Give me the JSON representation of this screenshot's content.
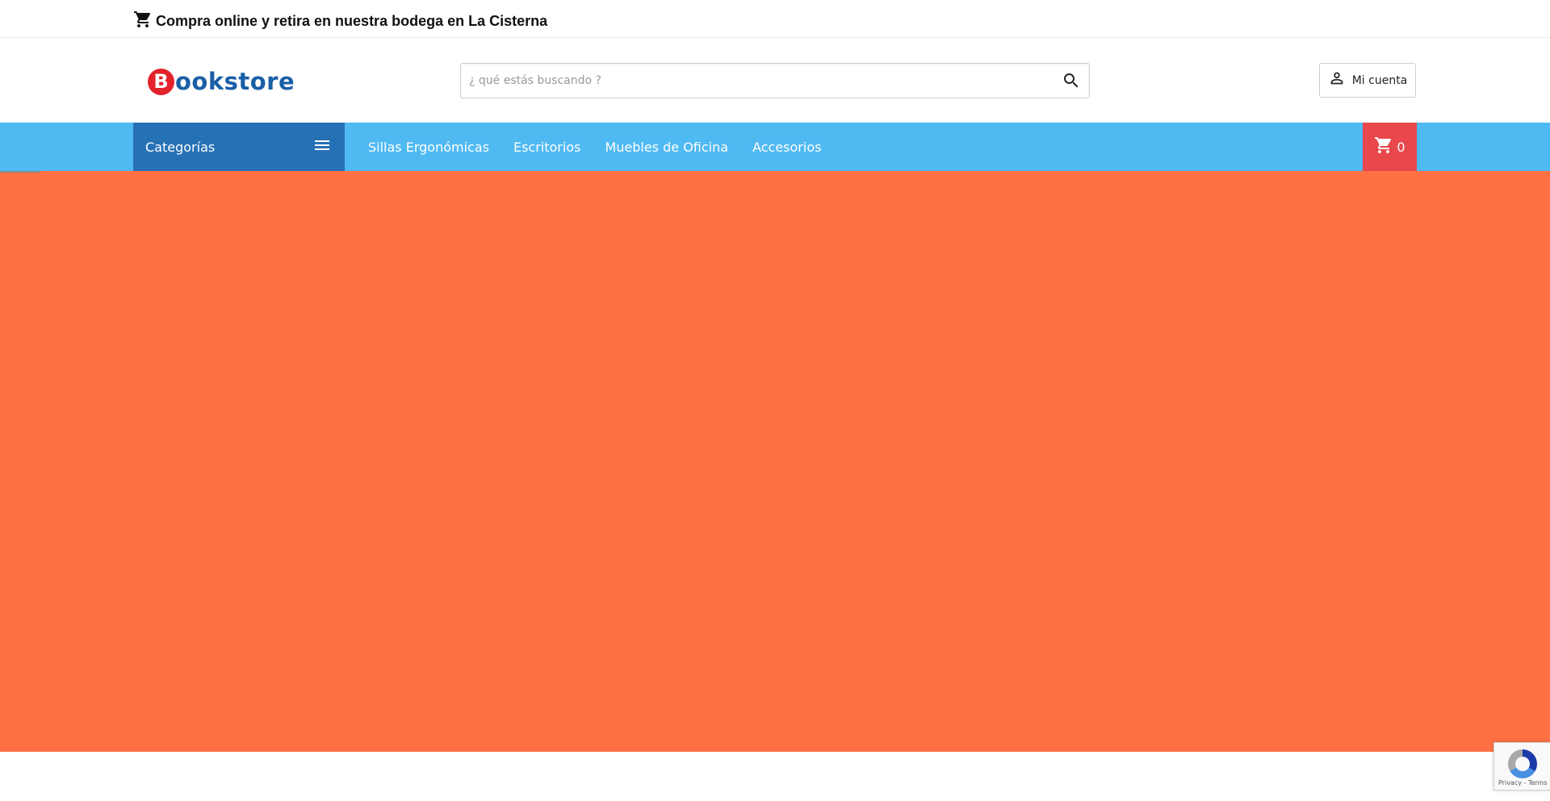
{
  "topbar": {
    "icon": "cart-icon",
    "message": "Compra online y retira en nuestra bodega en La Cisterna"
  },
  "header": {
    "logo": {
      "initial": "B",
      "rest": "ookstore",
      "brand_color": "#1a5fa6",
      "initial_bg": "#e2232b"
    },
    "search": {
      "placeholder": "¿ qué estás buscando ?",
      "value": "",
      "icon": "search-icon"
    },
    "account": {
      "label": "Mi cuenta",
      "icon": "user-icon"
    }
  },
  "navbar": {
    "background": "#4fb9f2",
    "categories": {
      "label": "Categorías",
      "icon": "menu-icon",
      "background": "#2671b6"
    },
    "links": [
      {
        "label": "Sillas Ergonómicas"
      },
      {
        "label": "Escritorios"
      },
      {
        "label": "Muebles de Oficina"
      },
      {
        "label": "Accesorios"
      }
    ],
    "cart": {
      "count": "0",
      "icon": "cart-icon",
      "background": "#e8474b"
    }
  },
  "hero": {
    "background": "#ff7043"
  },
  "recaptcha": {
    "footer": "Privacy - Terms"
  }
}
